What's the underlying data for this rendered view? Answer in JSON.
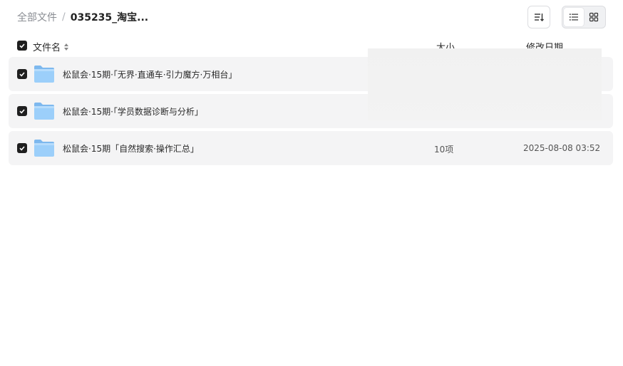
{
  "breadcrumb": {
    "root": "全部文件",
    "separator": "/",
    "current": "035235_淘宝..."
  },
  "toolbar": {
    "sort_icon": "sort-list-icon",
    "view_list_icon": "list-view-icon",
    "view_grid_icon": "grid-view-icon",
    "active_view": "list"
  },
  "table": {
    "columns": {
      "name": "文件名",
      "size": "大小",
      "date": "修改日期"
    },
    "rows": [
      {
        "name": "松鼠会·15期·「无界·直通车·引力魔方·万相台」",
        "size": "",
        "date": "",
        "checked": true,
        "icon": "folder-icon"
      },
      {
        "name": "松鼠会·15期·「学员数据诊断与分析」",
        "size": "",
        "date": "",
        "checked": true,
        "icon": "folder-icon"
      },
      {
        "name": "松鼠会·15期「自然搜索·操作汇总」",
        "size": "10项",
        "date": "2025-08-08 03:52",
        "checked": true,
        "icon": "folder-icon"
      }
    ]
  },
  "colors": {
    "checkbox": "#1f1f1f",
    "row_bg": "#f4f4f5",
    "folder": "#8ec5f5"
  }
}
